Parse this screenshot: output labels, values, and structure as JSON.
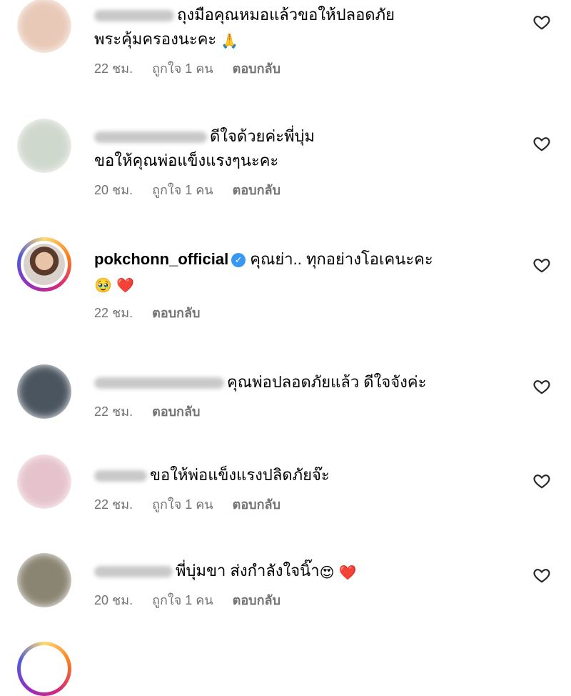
{
  "comments": [
    {
      "text_line1": "ถุงมือคุณหมอแล้วขอให้ปลอดภัย",
      "text_line2": "พระคุ้มครองนะคะ",
      "emoji": "🙏",
      "time": "22 ชม.",
      "likes": "ถูกใจ 1 คน",
      "reply": "ตอบกลับ",
      "avatar_color": "#e8c9b8"
    },
    {
      "text_line1": "ดีใจด้วยค่ะพี่บุ่ม",
      "text_line2": "ขอให้คุณพ่อแข็งแรงๆนะคะ",
      "time": "20 ชม.",
      "likes": "ถูกใจ 1 คน",
      "reply": "ตอบกลับ",
      "avatar_color": "#cfd8cc"
    },
    {
      "username": "pokchonn_official",
      "text_line1": "คุณย่า.. ทุกอย่างโอเคนะคะ",
      "emoji1": "🥹",
      "emoji2": "❤️",
      "time": "22 ชม.",
      "reply": "ตอบกลับ"
    },
    {
      "text_line1": "คุณพ่อปลอดภัยแล้ว ดีใจจังค่ะ",
      "time": "22 ชม.",
      "reply": "ตอบกลับ",
      "avatar_color": "#4a5560"
    },
    {
      "text_line1": "ขอให้พ่อแข็งแรงปลิดภัยจ๊ะ",
      "time": "22 ชม.",
      "likes": "ถูกใจ 1 คน",
      "reply": "ตอบกลับ",
      "avatar_color": "#e6c3cc"
    },
    {
      "text_line1": "พี่บุ่มขา ส่งกำลังใจนิ๊า",
      "emoji1": "😍",
      "emoji2": "❤️",
      "time": "20 ชม.",
      "likes": "ถูกใจ 1 คน",
      "reply": "ตอบกลับ",
      "avatar_color": "#8a8472"
    }
  ]
}
